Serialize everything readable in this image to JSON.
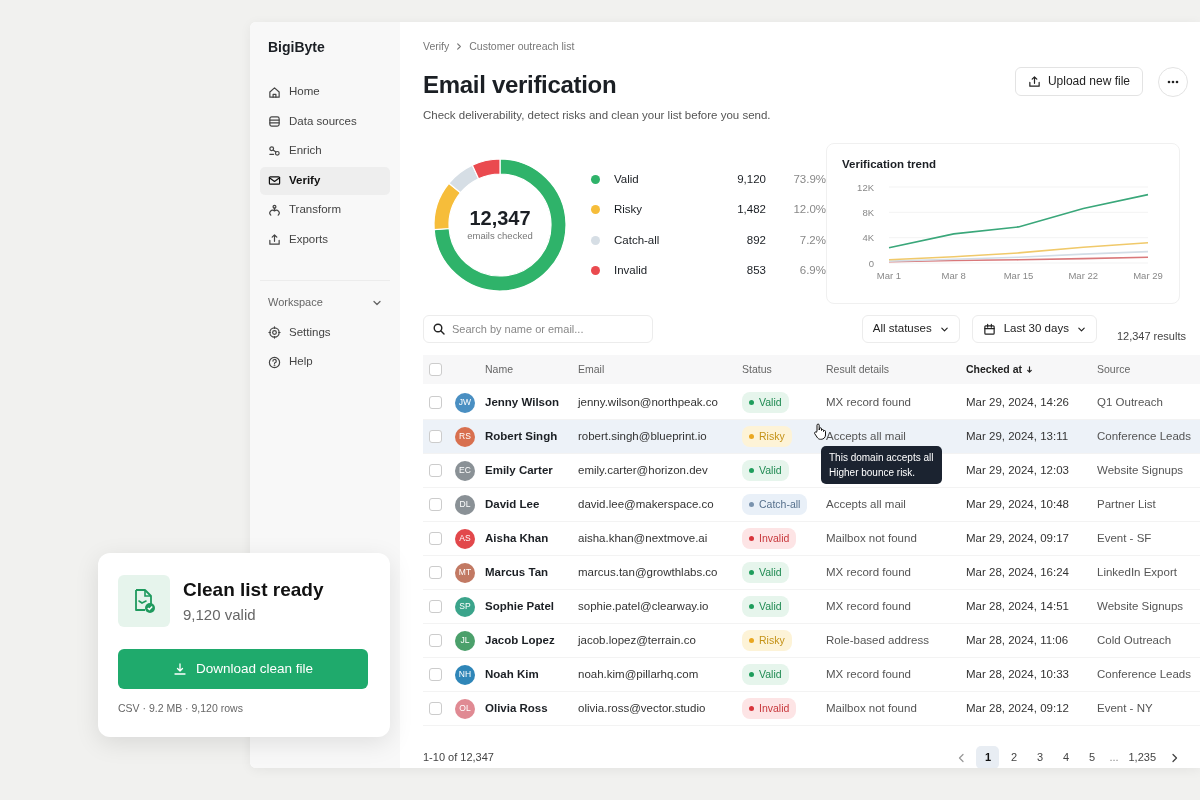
{
  "app": {
    "brand": "BigiByte"
  },
  "sidebar": {
    "items": [
      {
        "label": "Home",
        "selected": false
      },
      {
        "label": "Data sources",
        "selected": false
      },
      {
        "label": "Enrich",
        "selected": false
      },
      {
        "label": "Verify",
        "selected": true
      },
      {
        "label": "Transform",
        "selected": false
      },
      {
        "label": "Exports",
        "selected": false
      }
    ],
    "section": {
      "label": "Workspace",
      "expanded": true,
      "items": [
        {
          "label": "Settings"
        },
        {
          "label": "Help"
        }
      ]
    }
  },
  "breadcrumb": [
    "Verify",
    "Customer outreach list"
  ],
  "header": {
    "title": "Email verification",
    "subtitle": "Check deliverability, detect risks and clean your list before you send.",
    "upload_button": "Upload new file"
  },
  "summary": {
    "total": "12,347",
    "total_label": "emails checked",
    "legend": [
      {
        "count": "9,120",
        "percent": "73.9%",
        "color": "#2fb36a"
      },
      {
        "count": "1,482",
        "percent": "12.0%",
        "color": "#f6bd3a"
      },
      {
        "count": "892",
        "percent": "7.2%",
        "color": "#d6dee5"
      },
      {
        "count": "853",
        "percent": "6.9%",
        "color": "#ea4a4f"
      }
    ],
    "chart_data": {
      "type": "donut",
      "categories": [
        "Valid",
        "Risky",
        "Catch-all",
        "Invalid"
      ],
      "values": [
        73.9,
        12.0,
        7.2,
        6.9
      ]
    }
  },
  "trend": {
    "title": "Verification trend",
    "chart_data": {
      "type": "line",
      "categories": [
        "Mar 1",
        "Mar 8",
        "Mar 15",
        "Mar 22",
        "Mar 29"
      ],
      "ylim": [
        0,
        12000
      ],
      "yticks": [
        {
          "value": 0,
          "label": "0"
        },
        {
          "value": 4000,
          "label": "4K"
        },
        {
          "value": 8000,
          "label": "8K"
        },
        {
          "value": 12000,
          "label": "12K"
        }
      ],
      "series": [
        {
          "color": "#3aa77a",
          "values": [
            2400,
            4600,
            5700,
            8600,
            10800
          ]
        },
        {
          "color": "#f0c96a",
          "values": [
            500,
            1000,
            1600,
            2500,
            3200
          ]
        },
        {
          "color": "#d3dde6",
          "values": [
            300,
            600,
            900,
            1400,
            1800
          ]
        },
        {
          "color": "#d9787a",
          "values": [
            200,
            400,
            500,
            700,
            900
          ]
        }
      ]
    }
  },
  "filters": {
    "search_placeholder": "Search by name or email...",
    "status_filter": "All statuses",
    "date_filter": "Last 30 days",
    "results": "12,347 results"
  },
  "table": {
    "header_checked": false,
    "columns": [
      {
        "label": "Name",
        "sorted": false
      },
      {
        "label": "Email",
        "sorted": false
      },
      {
        "label": "Status",
        "sorted": false
      },
      {
        "label": "Result details",
        "sorted": false
      },
      {
        "label": "Checked at",
        "sorted": true
      },
      {
        "label": "Source",
        "sorted": false
      }
    ],
    "rows": [
      {
        "checked": false,
        "hovered": false,
        "initials": "JW",
        "color": "#4a8fc2",
        "name": "Jenny Wilson",
        "email": "jenny.wilson@northpeak.co",
        "status": {
          "label": "Valid",
          "kind": "valid"
        },
        "details": "MX record found",
        "checked_at": "Mar 29, 2024, 14:26",
        "source": "Q1 Outreach"
      },
      {
        "checked": false,
        "hovered": true,
        "initials": "RS",
        "color": "#d8704f",
        "name": "Robert Singh",
        "email": "robert.singh@blueprint.io",
        "status": {
          "label": "Risky",
          "kind": "risky"
        },
        "details": "Accepts all mail",
        "checked_at": "Mar 29, 2024, 13:11",
        "source": "Conference Leads",
        "tooltip": [
          "This domain accepts all",
          "Higher bounce risk."
        ]
      },
      {
        "checked": false,
        "hovered": false,
        "initials": "EC",
        "color": "#8a9196",
        "name": "Emily Carter",
        "email": "emily.carter@horizon.dev",
        "status": {
          "label": "Valid",
          "kind": "valid"
        },
        "checked_at": "Mar 29, 2024, 12:03",
        "source": "Website Signups"
      },
      {
        "checked": false,
        "hovered": false,
        "initials": "DL",
        "color": "#8a9196",
        "name": "David Lee",
        "email": "david.lee@makerspace.co",
        "status": {
          "label": "Catch-all",
          "kind": "catch-all"
        },
        "details": "Accepts all mail",
        "checked_at": "Mar 29, 2024, 10:48",
        "source": "Partner List"
      },
      {
        "checked": false,
        "hovered": false,
        "initials": "AS",
        "color": "#e2484b",
        "name": "Aisha Khan",
        "email": "aisha.khan@nextmove.ai",
        "status": {
          "label": "Invalid",
          "kind": "invalid"
        },
        "details": "Mailbox not found",
        "checked_at": "Mar 29, 2024, 09:17",
        "source": "Event - SF"
      },
      {
        "checked": false,
        "hovered": false,
        "initials": "MT",
        "color": "#c27963",
        "name": "Marcus Tan",
        "email": "marcus.tan@growthlabs.co",
        "status": {
          "label": "Valid",
          "kind": "valid"
        },
        "details": "MX record found",
        "checked_at": "Mar 28, 2024, 16:24",
        "source": "LinkedIn Export"
      },
      {
        "checked": false,
        "hovered": false,
        "initials": "SP",
        "color": "#3ba48b",
        "name": "Sophie Patel",
        "email": "sophie.patel@clearway.io",
        "status": {
          "label": "Valid",
          "kind": "valid"
        },
        "details": "MX record found",
        "checked_at": "Mar 28, 2024, 14:51",
        "source": "Website Signups"
      },
      {
        "checked": false,
        "hovered": false,
        "initials": "JL",
        "color": "#4ba06b",
        "name": "Jacob Lopez",
        "email": "jacob.lopez@terrain.co",
        "status": {
          "label": "Risky",
          "kind": "risky"
        },
        "details": "Role-based address",
        "checked_at": "Mar 28, 2024, 11:06",
        "source": "Cold Outreach"
      },
      {
        "checked": false,
        "hovered": false,
        "initials": "NH",
        "color": "#2f86b8",
        "name": "Noah Kim",
        "email": "noah.kim@pillarhq.com",
        "status": {
          "label": "Valid",
          "kind": "valid"
        },
        "details": "MX record found",
        "checked_at": "Mar 28, 2024, 10:33",
        "source": "Conference Leads"
      },
      {
        "checked": false,
        "hovered": false,
        "initials": "OL",
        "color": "#e08a93",
        "name": "Olivia Ross",
        "email": "olivia.ross@vector.studio",
        "status": {
          "label": "Invalid",
          "kind": "invalid"
        },
        "details": "Mailbox not found",
        "checked_at": "Mar 28, 2024, 09:12",
        "source": "Event - NY"
      }
    ]
  },
  "pagination": {
    "range": "1-10 of 12,347",
    "pages": [
      {
        "label": "1",
        "selected": true
      },
      {
        "label": "2",
        "selected": false
      },
      {
        "label": "3",
        "selected": false
      },
      {
        "label": "4",
        "selected": false
      },
      {
        "label": "5",
        "selected": false
      },
      {
        "label": "...",
        "kind": "gap"
      },
      {
        "label": "1,235",
        "selected": false
      }
    ]
  },
  "export_card": {
    "title": "Clean list ready",
    "subtitle": "9,120 valid",
    "button": "Download clean file",
    "meta": "CSV · 9.2 MB · 9,120 rows"
  }
}
